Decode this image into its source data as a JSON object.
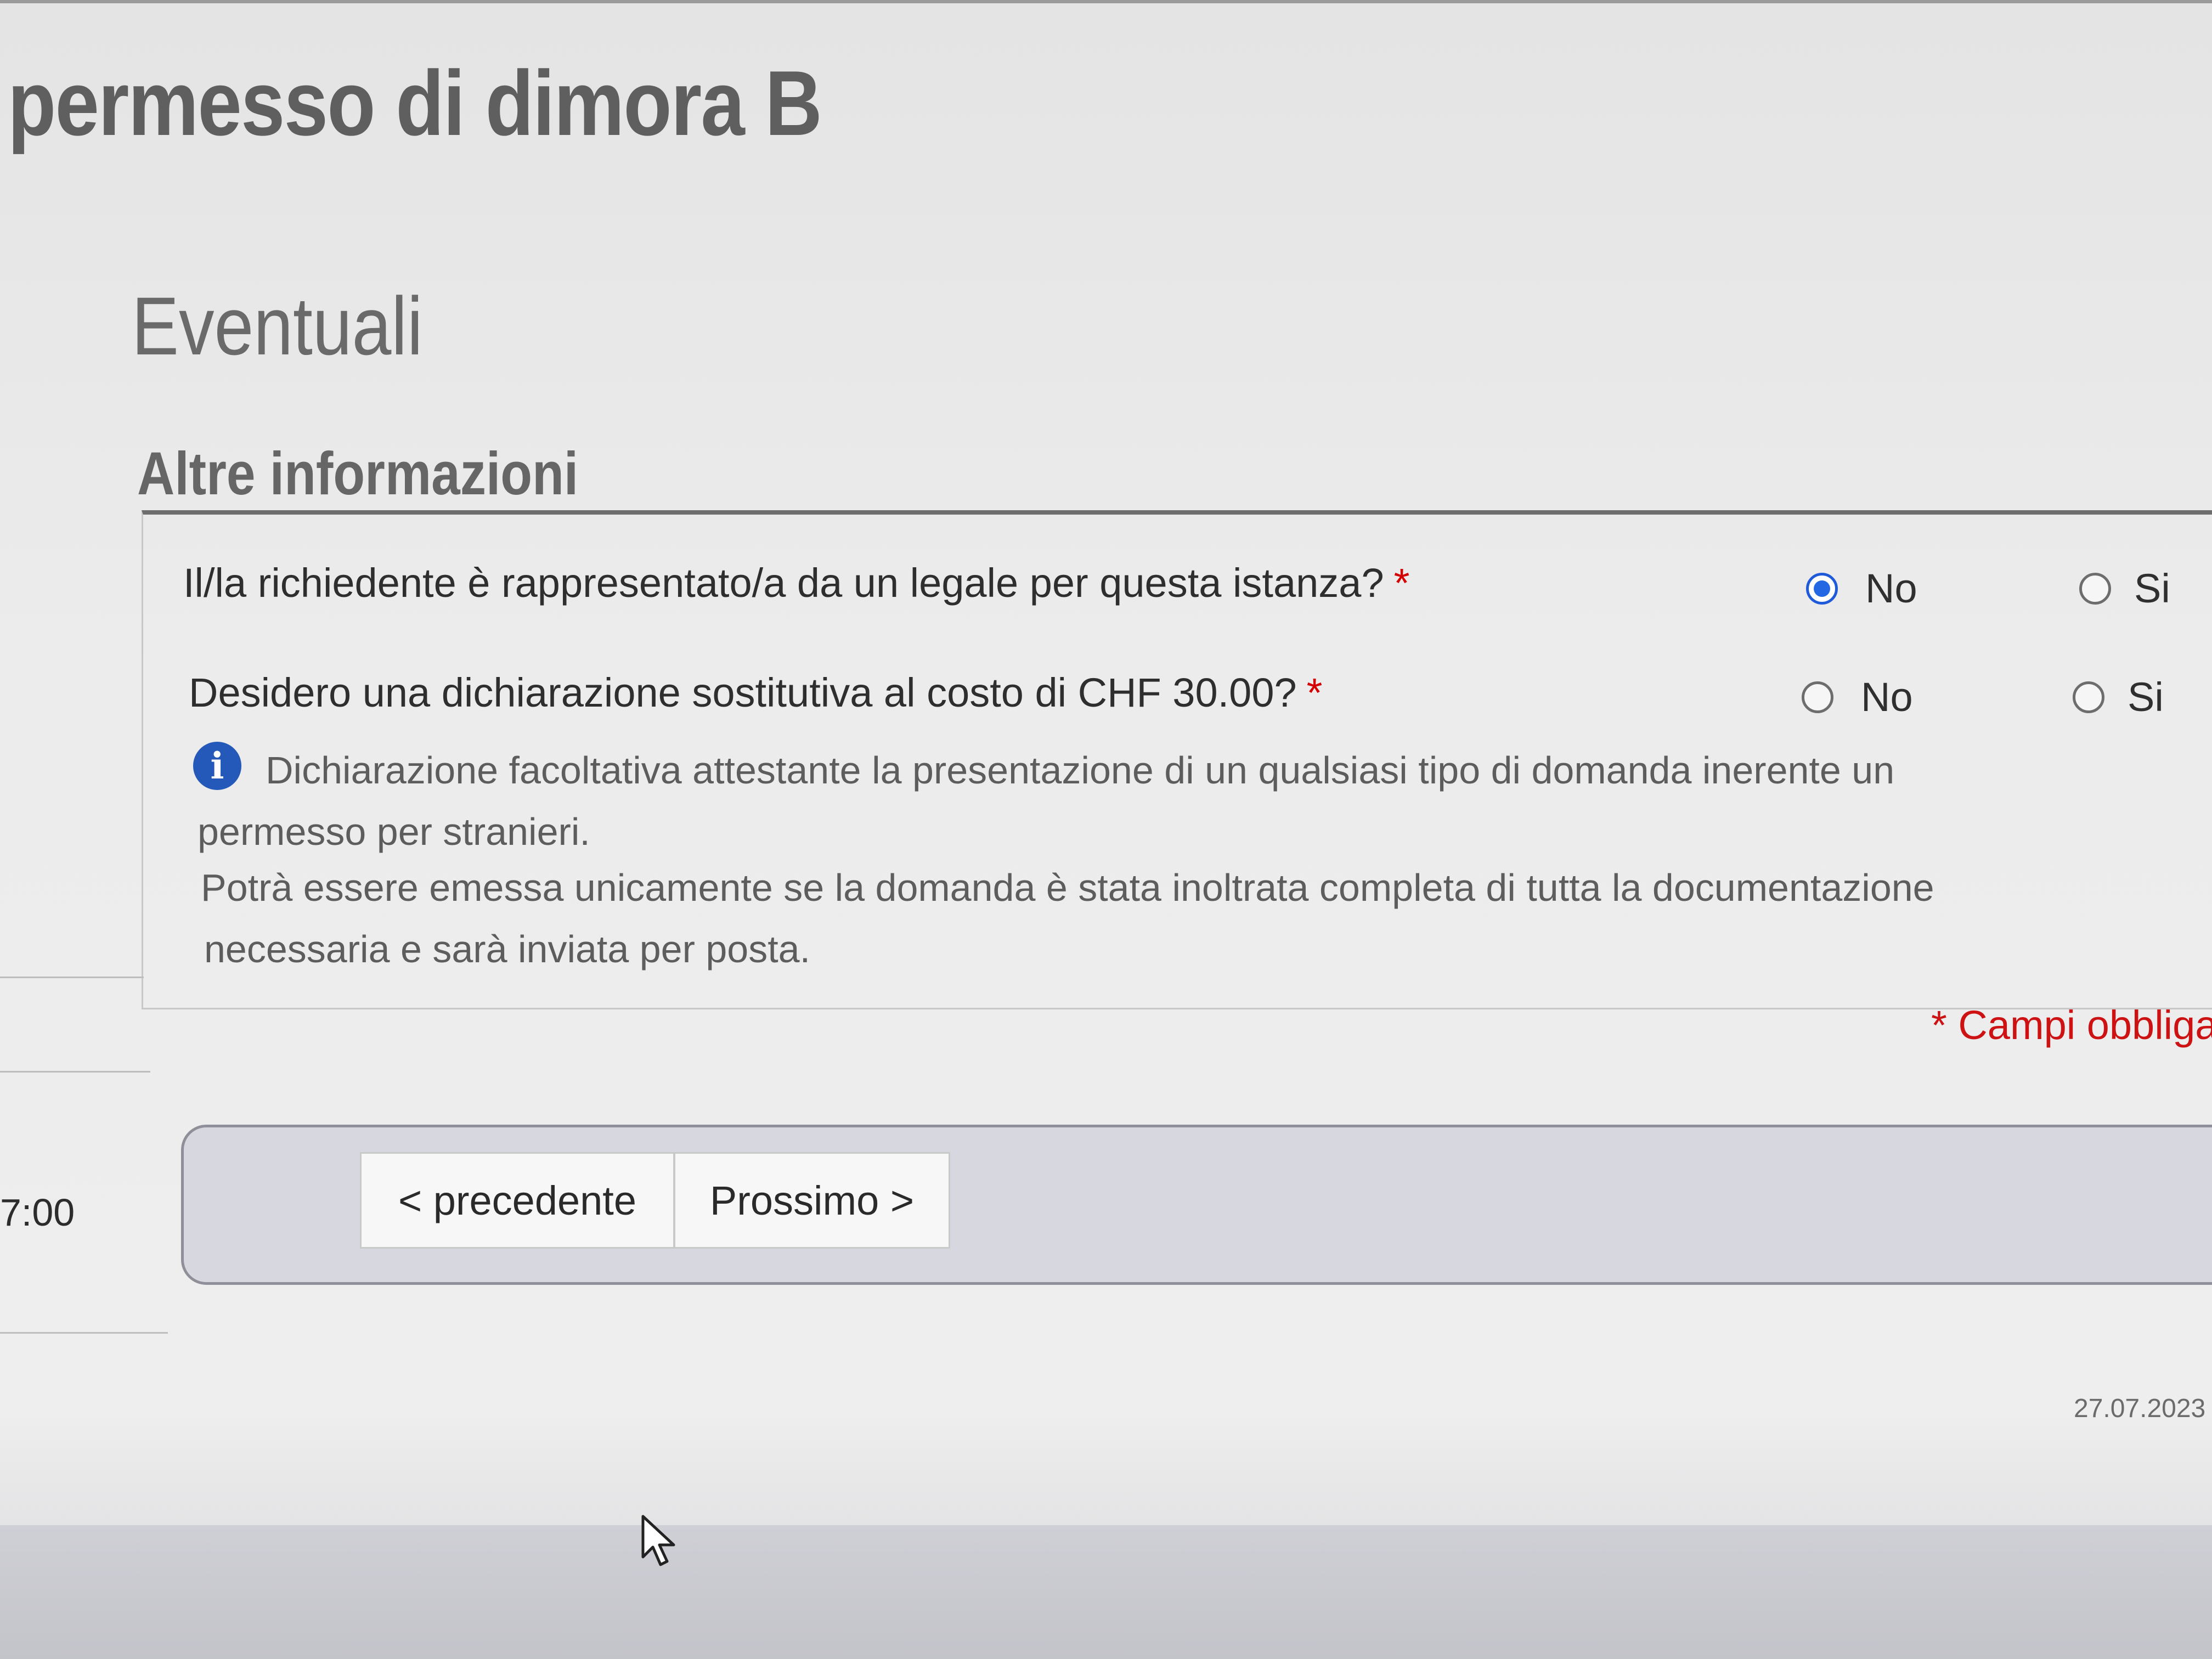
{
  "page": {
    "title": "permesso di dimora B",
    "section_title": "Eventuali"
  },
  "fieldset": {
    "legend": "Altre informazioni",
    "questions": [
      {
        "label": "Il/la richiedente è rappresentato/a da un legale per questa istanza?",
        "required_mark": "*",
        "options": [
          {
            "label": "No",
            "checked": true
          },
          {
            "label": "Si",
            "checked": false
          }
        ]
      },
      {
        "label": "Desidero una dichiarazione sostitutiva al costo di CHF 30.00?",
        "required_mark": "*",
        "options": [
          {
            "label": "No",
            "checked": false
          },
          {
            "label": "Si",
            "checked": false
          }
        ]
      }
    ],
    "info": {
      "lines": [
        "Dichiarazione facoltativa attestante la presentazione di un qualsiasi tipo di domanda inerente un",
        "permesso per stranieri.",
        "Potrà essere emessa unicamente se la domanda è stata inoltrata completa di tutta la documentazione",
        "necessaria e sarà inviata per posta."
      ]
    }
  },
  "required_note": "* Campi obbliga",
  "timer": "7:00",
  "navigation": {
    "prev_label": "< precedente",
    "next_label": "Prossimo >"
  },
  "footer": {
    "date": "27.07.2023"
  },
  "colors": {
    "accent": "#2367e3",
    "required": "#cc1212",
    "info_icon": "#2459b9"
  },
  "icons": {
    "info": "info-circle-icon",
    "cursor": "mouse-pointer-icon"
  }
}
